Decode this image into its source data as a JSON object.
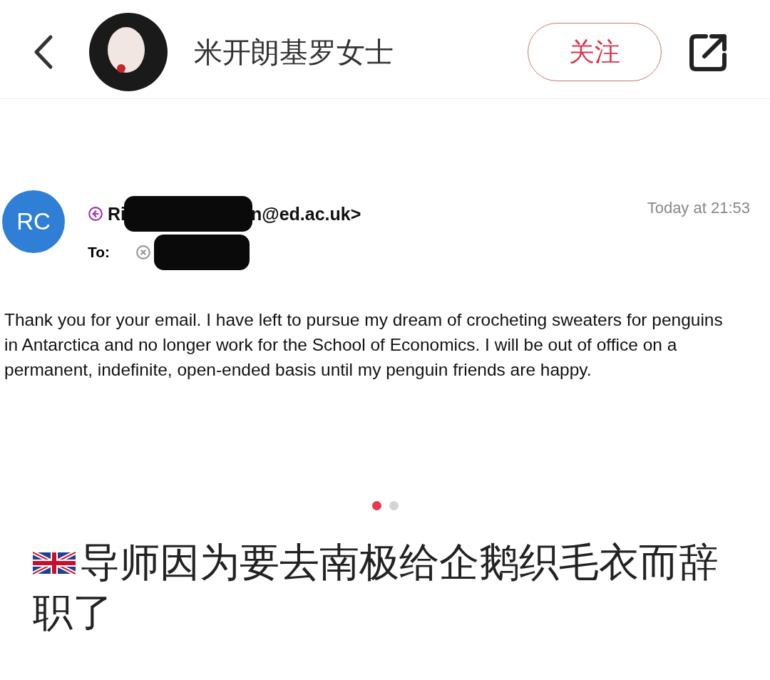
{
  "header": {
    "author": "米开朗基罗女士",
    "follow_button": "关注"
  },
  "email": {
    "avatar_initials": "RC",
    "sender_start": "Ri",
    "sender_end": "n@ed.ac.uk>",
    "time": "Today at 21:53",
    "to_label": "To:",
    "body": "Thank you for your email. I have left to pursue my dream of crocheting sweaters for penguins in Antarctica and no longer work for the School of Economics. I will be out of office on a permanent, indefinite, open-ended basis until my penguin friends are happy."
  },
  "carousel_dots": [
    {
      "selected": true
    },
    {
      "selected": false
    }
  ],
  "post_title": "导师因为要去南极给企鹅织毛衣而辞职了"
}
